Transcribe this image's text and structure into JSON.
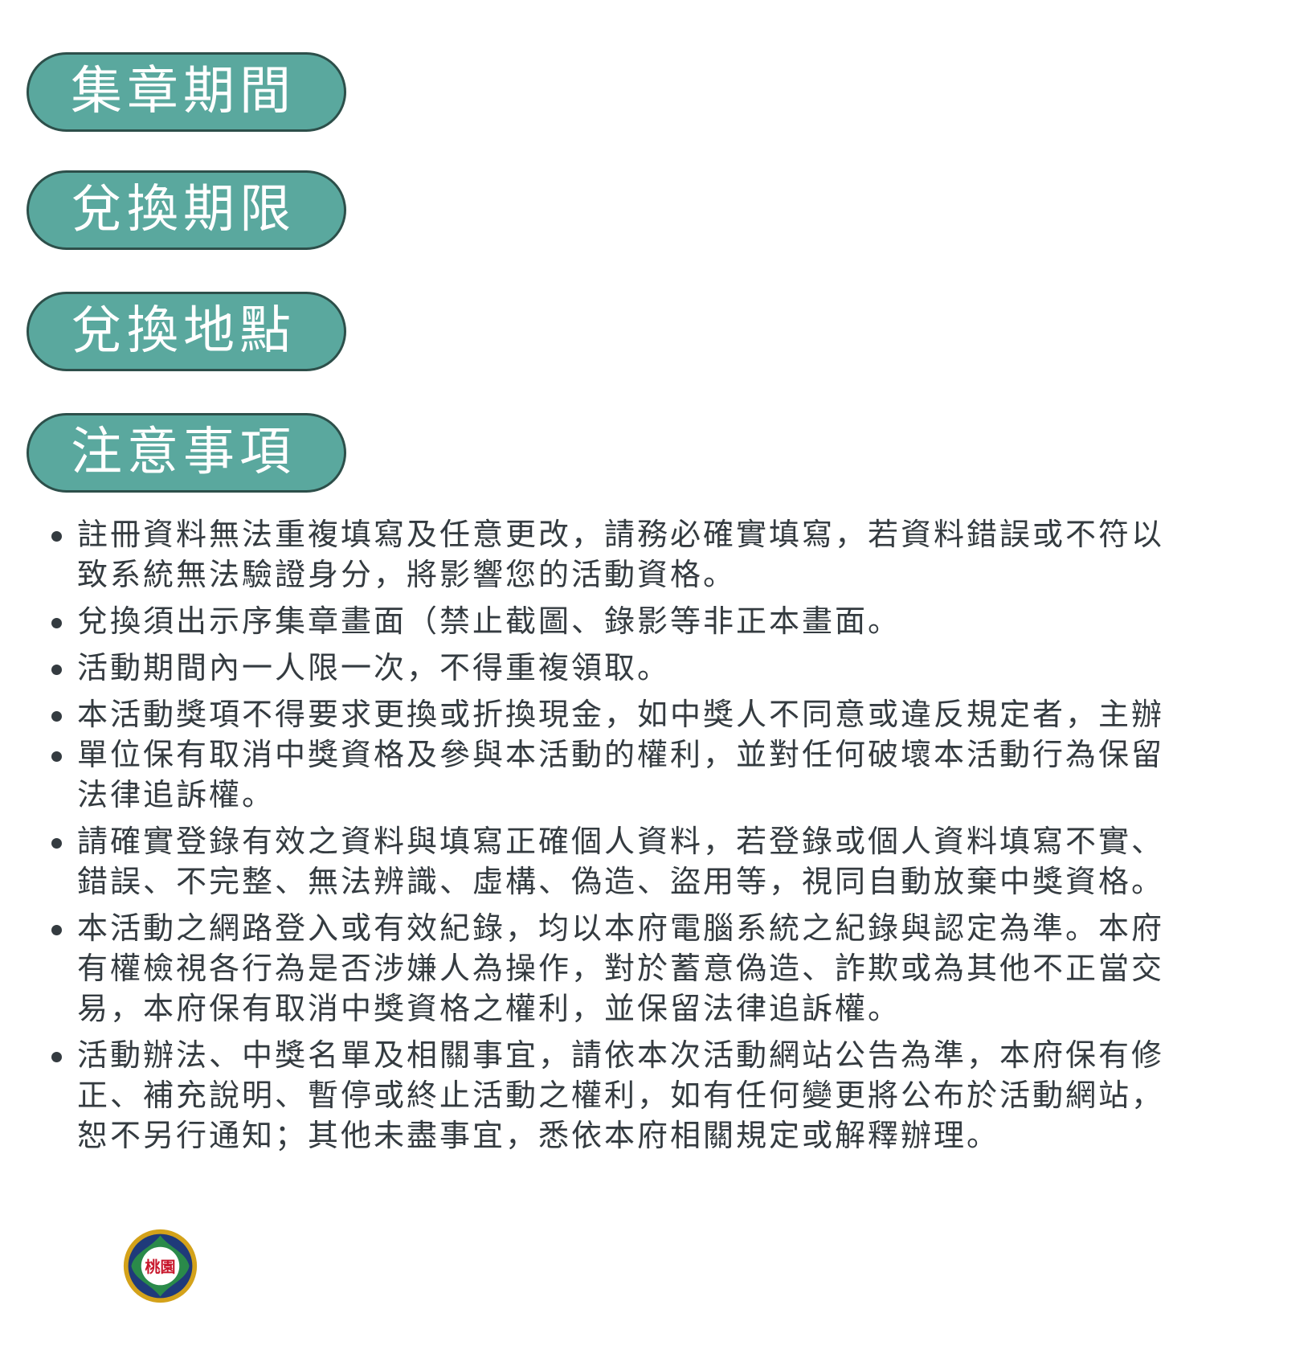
{
  "sections": [
    {
      "label": "集章期間"
    },
    {
      "label": "兌換期限"
    },
    {
      "label": "兌換地點"
    },
    {
      "label": "注意事項"
    }
  ],
  "notes": [
    "註冊資料無法重複填寫及任意更改，請務必確實填寫，若資料錯誤或不符以\n致系統無法驗證身分，將影響您的活動資格。",
    "兌換須出示序集章畫面（禁止截圖、錄影等非正本畫面。",
    "活動期間內一人限一次，不得重複領取。",
    "本活動獎項不得要求更換或折換現金，如中獎人不同意或違反規定者，主辦",
    "單位保有取消中獎資格及參與本活動的權利，並對任何破壞本活動行為保留\n法律追訴權。",
    "請確實登錄有效之資料與填寫正確個人資料，若登錄或個人資料填寫不實、\n錯誤、不完整、無法辨識、虛構、偽造、盜用等，視同自動放棄中獎資格。",
    "本活動之網路登入或有效紀錄，均以本府電腦系統之紀錄與認定為準。本府\n有權檢視各行為是否涉嫌人為操作，對於蓄意偽造、詐欺或為其他不正當交\n易，本府保有取消中獎資格之權利，並保留法律追訴權。",
    "活動辦法、中獎名單及相關事宜，請依本次活動網站公告為準，本府保有修\n正、補充說明、暫停或終止活動之權利，如有任何變更將公布於活動網站，\n恕不另行通知；其他未盡事宜，悉依本府相關規定或解釋辦理。"
  ],
  "emblem": {
    "text": "桃園",
    "colors": {
      "outer_ring": "#d4a21a",
      "inner_ring": "#1f3a7a",
      "petal": "#2a8a4a",
      "center": "#ffffff",
      "text": "#c8162b"
    }
  },
  "colors": {
    "pill_fill": "#5aa89e",
    "pill_border": "#2d4f4a",
    "body_text": "#343b40"
  }
}
